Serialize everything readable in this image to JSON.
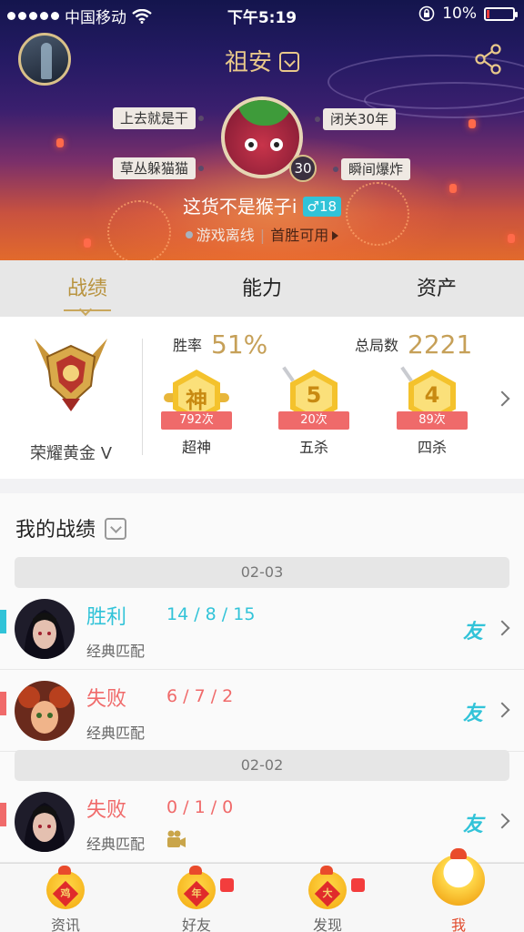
{
  "status_bar": {
    "carrier": "中国移动",
    "time": "下午5:19",
    "battery": "10%",
    "battery_level": 0.1
  },
  "header": {
    "username": "祖安",
    "tags_left": [
      "上去就是干",
      "草丛躲猫猫"
    ],
    "tags_right": [
      "闭关30年",
      "瞬间爆炸"
    ],
    "level": "30",
    "nickname": "这货不是猴子i",
    "gender_age": "♂18",
    "status": "游戏离线",
    "status_link": "首胜可用"
  },
  "tabs": [
    {
      "label": "战绩",
      "active": true
    },
    {
      "label": "能力",
      "active": false
    },
    {
      "label": "资产",
      "active": false
    }
  ],
  "stats": {
    "rank": "荣耀黄金 V",
    "winrate_label": "胜率",
    "winrate": "51%",
    "games_label": "总局数",
    "games": "2221",
    "badges": [
      {
        "char": "神",
        "count": "792次",
        "label": "超神"
      },
      {
        "char": "5",
        "count": "20次",
        "label": "五杀"
      },
      {
        "char": "4",
        "count": "89次",
        "label": "四杀"
      }
    ]
  },
  "records": {
    "title": "我的战绩",
    "date1": "02-03",
    "date2": "02-02",
    "items": [
      {
        "result": "胜利",
        "kda": "14 / 8 / 15",
        "mode": "经典匹配",
        "friend": "友"
      },
      {
        "result": "失败",
        "kda": "6 / 7 / 2",
        "mode": "经典匹配",
        "friend": "友"
      },
      {
        "result": "失败",
        "kda": "0 / 1 / 0",
        "mode": "经典匹配",
        "friend": "友"
      }
    ]
  },
  "tabbar": [
    {
      "label": "资讯",
      "icon": "鸡"
    },
    {
      "label": "好友",
      "icon": "年"
    },
    {
      "label": "发现",
      "icon": "大"
    },
    {
      "label": "我",
      "icon": ""
    }
  ],
  "colors": {
    "accent_gold": "#c6a058",
    "win": "#31c3d8",
    "loss": "#f06a6a",
    "tab_active": "#e14b2d"
  },
  "icons": [
    "signal-dots-icon",
    "wifi-icon",
    "lock-rotation-icon",
    "battery-icon",
    "dropdown-icon",
    "share-icon",
    "rank-emblem-icon",
    "chevron-right-icon",
    "video-icon",
    "chick-icon"
  ]
}
